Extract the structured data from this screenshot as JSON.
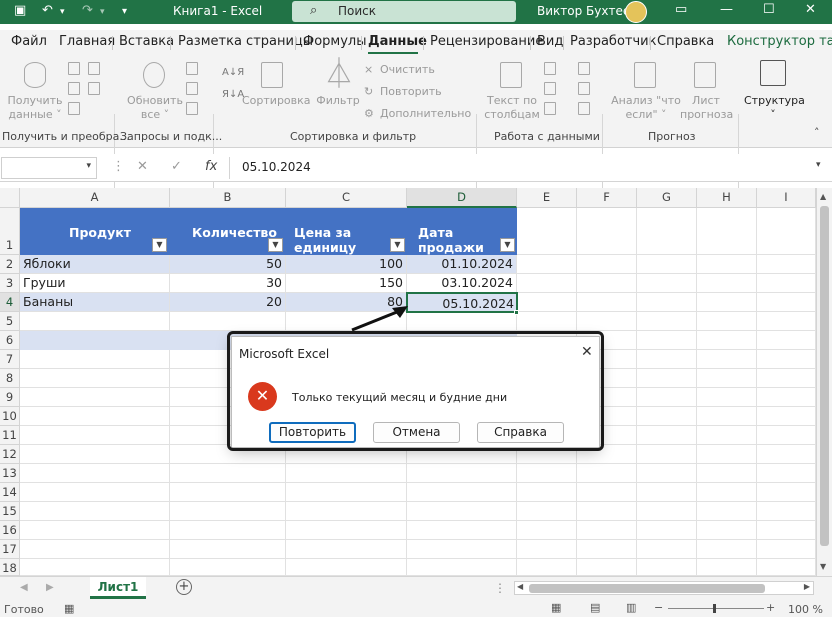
{
  "titlebar": {
    "doc_title": "Книга1  -  Excel",
    "search_label": "Поиск",
    "user_name": "Виктор Бухтеев"
  },
  "ribbon_tabs": [
    {
      "label": "Файл"
    },
    {
      "label": "Главная"
    },
    {
      "label": "Вставка"
    },
    {
      "label": "Разметка страницы"
    },
    {
      "label": "Формулы"
    },
    {
      "label": "Данные",
      "active": true
    },
    {
      "label": "Рецензирование"
    },
    {
      "label": "Вид"
    },
    {
      "label": "Разработчик"
    },
    {
      "label": "Справка"
    },
    {
      "label": "Конструктор та"
    }
  ],
  "ribbon": {
    "get_data": "Получить\nданные ˅",
    "refresh_all": "Обновить\nвсе ˅",
    "sort": "Сортировка",
    "filter": "Фильтр",
    "clear": "Очистить",
    "reapply": "Повторить",
    "advanced": "Дополнительно",
    "text_to_columns": "Текст по\nстолбцам",
    "whatif": "Анализ \"что\nесли\" ˅",
    "forecast_sheet": "Лист\nпрогноза",
    "outline": "Структура\n˅",
    "groups": {
      "get_transform": "Получить и преобра...",
      "queries": "Запросы и подк...",
      "sort_filter": "Сортировка и фильтр",
      "data_tools": "Работа с данными",
      "forecast": "Прогноз"
    }
  },
  "formula_bar": {
    "name_box": "",
    "fx": "fx",
    "formula": "05.10.2024"
  },
  "columns": [
    "A",
    "B",
    "C",
    "D",
    "E",
    "F",
    "G",
    "H",
    "I"
  ],
  "rows": [
    "1",
    "2",
    "3",
    "4",
    "5",
    "6",
    "7",
    "8",
    "9",
    "10",
    "11",
    "12",
    "13",
    "14",
    "15",
    "16",
    "17",
    "18"
  ],
  "table": {
    "headers": [
      "Продукт",
      "Количество",
      "Цена за единицу",
      "Дата продажи"
    ],
    "rows": [
      [
        "Яблоки",
        "50",
        "100",
        "01.10.2024"
      ],
      [
        "Груши",
        "30",
        "150",
        "03.10.2024"
      ],
      [
        "Бананы",
        "20",
        "80",
        "05.10.2024"
      ]
    ]
  },
  "sheet_tabs": [
    {
      "label": "Лист1",
      "active": true
    }
  ],
  "status": {
    "ready": "Готово",
    "zoom": "100 %"
  },
  "dialog": {
    "title": "Microsoft Excel",
    "message": "Только текущий месяц и будние дни",
    "buttons": [
      "Повторить",
      "Отмена",
      "Справка"
    ]
  },
  "colors": {
    "excel_green": "#217346",
    "table_header": "#4472c4",
    "band_row": "#d9e1f2",
    "error_icon": "#d9391d"
  }
}
